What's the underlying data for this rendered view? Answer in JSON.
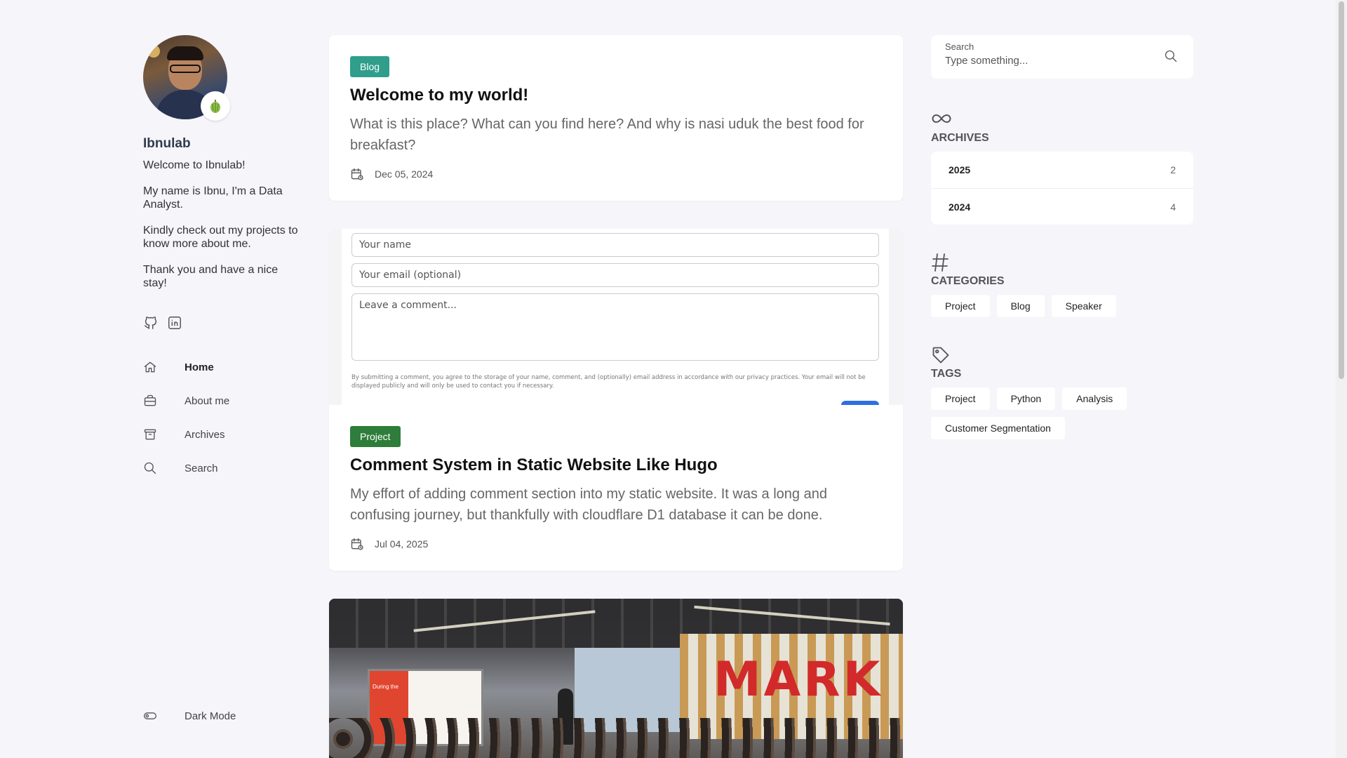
{
  "profile": {
    "name": "Ibnulab",
    "intro": [
      "Welcome to Ibnulab!",
      "My name is Ibnu, I'm a Data Analyst.",
      "Kindly check out my projects to know more about me.",
      "Thank you and have a nice stay!"
    ]
  },
  "nav": {
    "items": [
      {
        "label": "Home",
        "icon": "home-icon"
      },
      {
        "label": "About me",
        "icon": "briefcase-icon"
      },
      {
        "label": "Archives",
        "icon": "archive-icon"
      },
      {
        "label": "Search",
        "icon": "search-icon"
      }
    ],
    "dark_mode": "Dark Mode"
  },
  "posts": [
    {
      "category": "Blog",
      "title": "Welcome to my world!",
      "description": "What is this place? What can you find here? And why is nasi uduk the best food for breakfast?",
      "date": "Dec 05, 2024"
    },
    {
      "category": "Project",
      "title": "Comment System in Static Website Like Hugo",
      "description": "My effort of adding comment section into my static website. It was a long and confusing journey, but thankfully with cloudflare D1 database it can be done.",
      "date": "Jul 04, 2025",
      "thumbnail": {
        "name_placeholder": "Your name",
        "email_placeholder": "Your email (optional)",
        "comment_placeholder": "Leave a comment...",
        "fine_print": "By submitting a comment, you agree to the storage of your name, comment, and (optionally) email address in accordance with our privacy practices. Your email will not be displayed publicly and will only be used to contact you if necessary."
      }
    },
    {
      "thumbnail": {
        "screen_text": "During the",
        "wall_text": "MARK"
      }
    }
  ],
  "search": {
    "label": "Search",
    "placeholder": "Type something..."
  },
  "archives": {
    "title": "ARCHIVES",
    "items": [
      {
        "year": "2025",
        "count": "2"
      },
      {
        "year": "2024",
        "count": "4"
      }
    ]
  },
  "categories": {
    "title": "CATEGORIES",
    "items": [
      "Project",
      "Blog",
      "Speaker"
    ]
  },
  "tags": {
    "title": "TAGS",
    "items": [
      "Project",
      "Python",
      "Analysis",
      "Customer Segmentation"
    ]
  },
  "colors": {
    "blog_badge": "#2f9e8a",
    "project_badge": "#2e7d3a",
    "background": "#f5f5fa"
  }
}
